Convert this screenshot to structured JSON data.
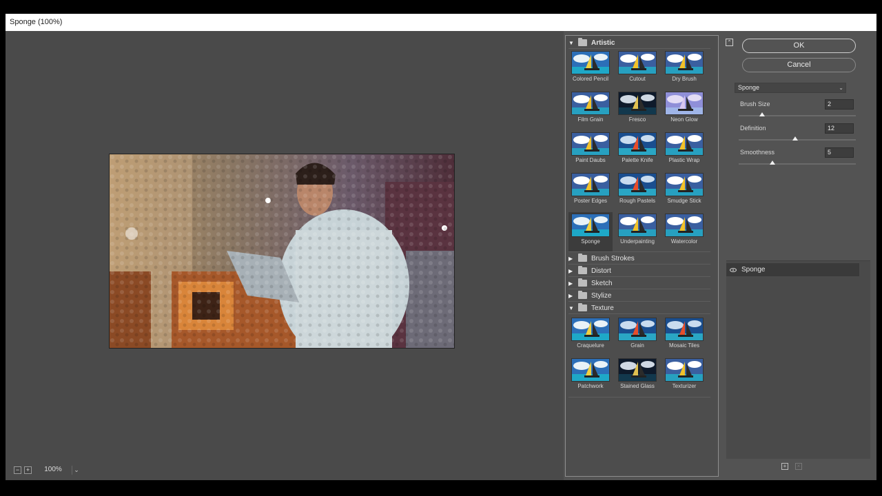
{
  "window": {
    "title": "Sponge (100%)"
  },
  "preview": {
    "zoom": "100%",
    "zoom_out_icon": "minus-icon",
    "zoom_in_icon": "plus-icon"
  },
  "gallery": {
    "categories": [
      {
        "label": "Artistic",
        "open": true
      },
      {
        "label": "Brush Strokes",
        "open": false
      },
      {
        "label": "Distort",
        "open": false
      },
      {
        "label": "Sketch",
        "open": false
      },
      {
        "label": "Stylize",
        "open": false
      },
      {
        "label": "Texture",
        "open": true
      }
    ],
    "artistic": [
      "Colored Pencil",
      "Cutout",
      "Dry Brush",
      "Film Grain",
      "Fresco",
      "Neon Glow",
      "Paint Daubs",
      "Palette Knife",
      "Plastic Wrap",
      "Poster Edges",
      "Rough Pastels",
      "Smudge Stick",
      "Sponge",
      "Underpainting",
      "Watercolor"
    ],
    "texture": [
      "Craquelure",
      "Grain",
      "Mosaic Tiles",
      "Patchwork",
      "Stained Glass",
      "Texturizer"
    ],
    "selected": "Sponge"
  },
  "buttons": {
    "ok": "OK",
    "cancel": "Cancel"
  },
  "settings": {
    "filter": "Sponge",
    "params": [
      {
        "label": "Brush Size",
        "value": "2",
        "fraction": 0.2
      },
      {
        "label": "Definition",
        "value": "12",
        "fraction": 0.48
      },
      {
        "label": "Smoothness",
        "value": "5",
        "fraction": 0.29
      }
    ]
  },
  "layers": {
    "items": [
      "Sponge"
    ]
  },
  "colors": {
    "accent": "#535353",
    "selection": "#3a3a3a"
  }
}
